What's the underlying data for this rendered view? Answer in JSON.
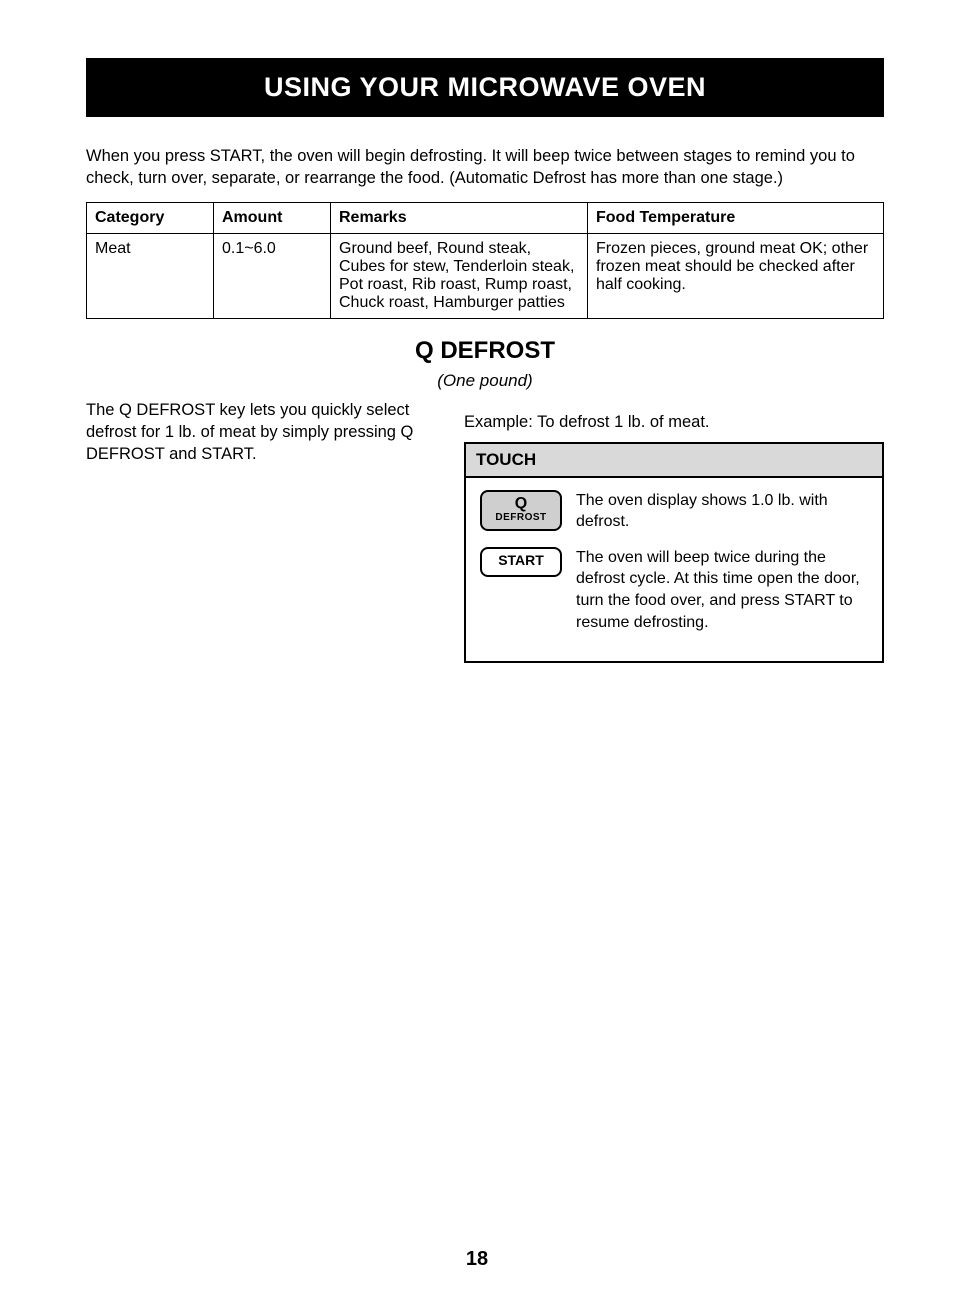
{
  "banner": "USING YOUR MICROWAVE OVEN",
  "intro": "When you press START, the oven will begin defrosting. It will beep twice between stages to remind you to check, turn over, separate, or rearrange the food. (Automatic Defrost has more than one stage.)",
  "table": {
    "headers": [
      "Category",
      "Amount",
      "Remarks",
      "Food Temperature"
    ],
    "row": {
      "category": "Meat",
      "amount": "0.1~6.0",
      "remarks": "Ground beef, Round steak, Cubes for stew, Tenderloin steak, Pot roast, Rib roast, Rump roast, Chuck roast, Hamburger patties",
      "temp": "Frozen pieces, ground meat OK; other frozen meat should be checked after half cooking."
    }
  },
  "section": {
    "title": "Q DEFROST",
    "subtitle": "(One pound)",
    "left": "The Q DEFROST key lets you quickly select defrost for 1 lb. of meat by simply pressing Q DEFROST and START.",
    "lead": "Example: To defrost 1 lb. of meat.",
    "panel_header": "TOUCH",
    "steps": [
      {
        "key_top": "Q",
        "key_bottom": "DEFROST",
        "key_name": "q-defrost-key",
        "text": "The oven display shows 1.0 lb. with defrost."
      },
      {
        "key_top": "START",
        "key_bottom": "",
        "key_name": "start-key",
        "text": "The oven will beep twice during the defrost cycle. At this time open the door, turn the food over, and press START to resume defrosting."
      }
    ]
  },
  "page_number": "18"
}
